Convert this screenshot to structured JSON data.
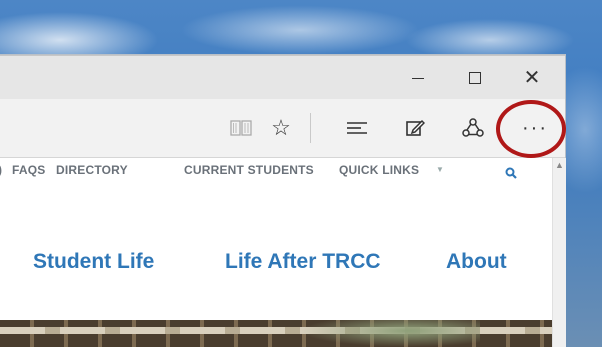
{
  "window": {
    "controls": {
      "minimize_icon": "minimize-icon",
      "maximize_icon": "maximize-icon",
      "close_icon": "close-icon",
      "close_glyph": "✕"
    }
  },
  "toolbar": {
    "star_glyph": "☆",
    "more_glyph": "···"
  },
  "site": {
    "topnav": {
      "cut_item": ")",
      "items": [
        "FAQS",
        "DIRECTORY",
        "CURRENT STUDENTS",
        "QUICK LINKS"
      ],
      "caret": "▼"
    },
    "mainnav": [
      "Student Life",
      "Life After TRCC",
      "About"
    ]
  },
  "colors": {
    "highlight_ring": "#b01818",
    "link_blue": "#2f77b7"
  }
}
